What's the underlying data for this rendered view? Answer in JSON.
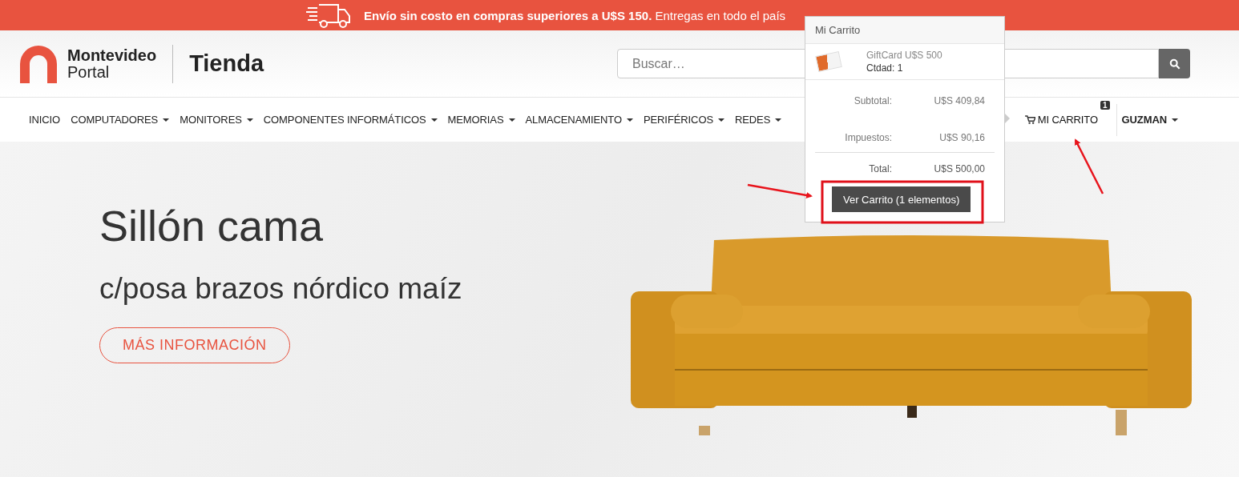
{
  "banner": {
    "text": "**Envío sin costo en compras superiores a U$S 150.** Entregas en todo el país"
  },
  "header": {
    "logo_line_1": "Montevideo",
    "logo_line_2": "Portal",
    "section": "Tienda",
    "search": {
      "placeholder": "Buscar…"
    }
  },
  "nav": {
    "items": [
      {
        "label": "INICIO",
        "has_menu": false
      },
      {
        "label": "COMPUTADORES",
        "has_menu": true
      },
      {
        "label": "MONITORES",
        "has_menu": true
      },
      {
        "label": "COMPONENTES INFORMÁTICOS",
        "has_menu": true
      },
      {
        "label": "MEMORIAS",
        "has_menu": true
      },
      {
        "label": "ALMACENAMIENTO",
        "has_menu": true
      },
      {
        "label": "PERIFÉRICOS",
        "has_menu": true
      },
      {
        "label": "REDES",
        "has_menu": true
      }
    ],
    "cart": {
      "label": "MI CARRITO",
      "count": "1",
      "expanded": true
    },
    "user": {
      "label": "GUZMAN",
      "has_menu": true
    }
  },
  "cart_popup": {
    "title": "Mi Carrito",
    "items": [
      {
        "name": "GiftCard U$S 500",
        "quantity": "Ctdad: 1"
      }
    ],
    "summary": [
      {
        "label": "Subtotal:",
        "value": "U$S 409,84"
      },
      {
        "label": "Impuestos:",
        "value": "U$S 90,16"
      }
    ],
    "total": {
      "label": "Total:",
      "value": "U$S 500,00"
    },
    "button": "Ver Carrito (1 elementos)"
  },
  "hero": {
    "title": "Sillón cama",
    "subtitle": "c/posa brazos nórdico maíz",
    "button": "MÁS INFORMACIÓN"
  }
}
